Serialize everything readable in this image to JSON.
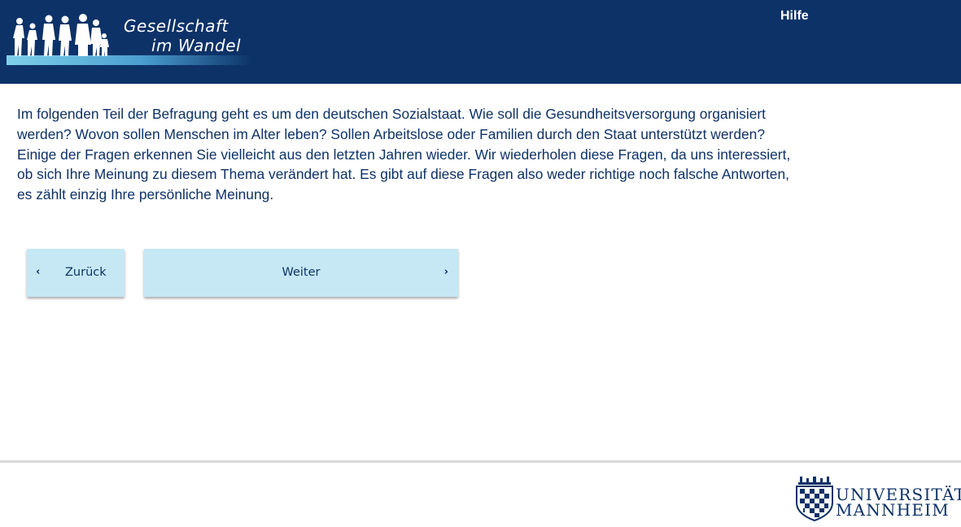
{
  "header": {
    "logo": {
      "line1": "Gesellschaft",
      "line2": "im Wandel"
    },
    "help_label": "Hilfe"
  },
  "main": {
    "intro_text": "Im folgenden Teil der Befragung geht es um den deutschen Sozialstaat. Wie soll die Gesundheitsversorgung organisiert werden? Wovon sollen Menschen im Alter leben? Sollen Arbeitslose oder Familien durch den Staat unterstützt werden? Einige der Fragen erkennen Sie vielleicht aus den letzten Jahren wieder. Wir wiederholen diese Fragen, da uns interessiert, ob sich Ihre Meinung zu diesem Thema verändert hat. Es gibt auf diese Fragen also weder richtige noch falsche Antworten, es zählt einzig Ihre persönliche Meinung."
  },
  "navigation": {
    "back_label": "Zurück",
    "back_icon": "chevron-left-icon",
    "next_label": "Weiter",
    "next_icon": "chevron-right-icon"
  },
  "footer": {
    "university_line1": "UNIVERSITÄT",
    "university_line2": "MANNHEIM"
  },
  "colors": {
    "header_bg": "#0d3268",
    "button_bg": "#c6e8f5",
    "text": "#0d3268"
  }
}
